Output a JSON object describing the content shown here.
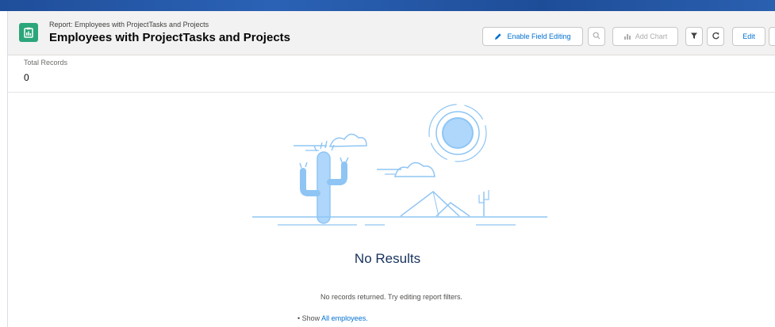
{
  "header": {
    "eyebrow": "Report: Employees with ProjectTasks and Projects",
    "title": "Employees with ProjectTasks and Projects",
    "report_icon": "report-icon"
  },
  "toolbar": {
    "enable_field_editing": "Enable Field Editing",
    "add_chart": "Add Chart",
    "edit": "Edit",
    "icons": [
      "pencil-icon",
      "search-icon",
      "chart-icon",
      "filter-icon",
      "refresh-icon"
    ]
  },
  "summary": {
    "total_records_label": "Total Records",
    "total_records_value": "0"
  },
  "empty_state": {
    "heading": "No Results",
    "message": "No records returned. Try editing report filters.",
    "show_prefix": "• Show ",
    "show_link": "All employees."
  },
  "colors": {
    "brand_blue": "#0070d2",
    "report_green": "#2ba67a",
    "illustration_blue": "#8fc5f4"
  }
}
